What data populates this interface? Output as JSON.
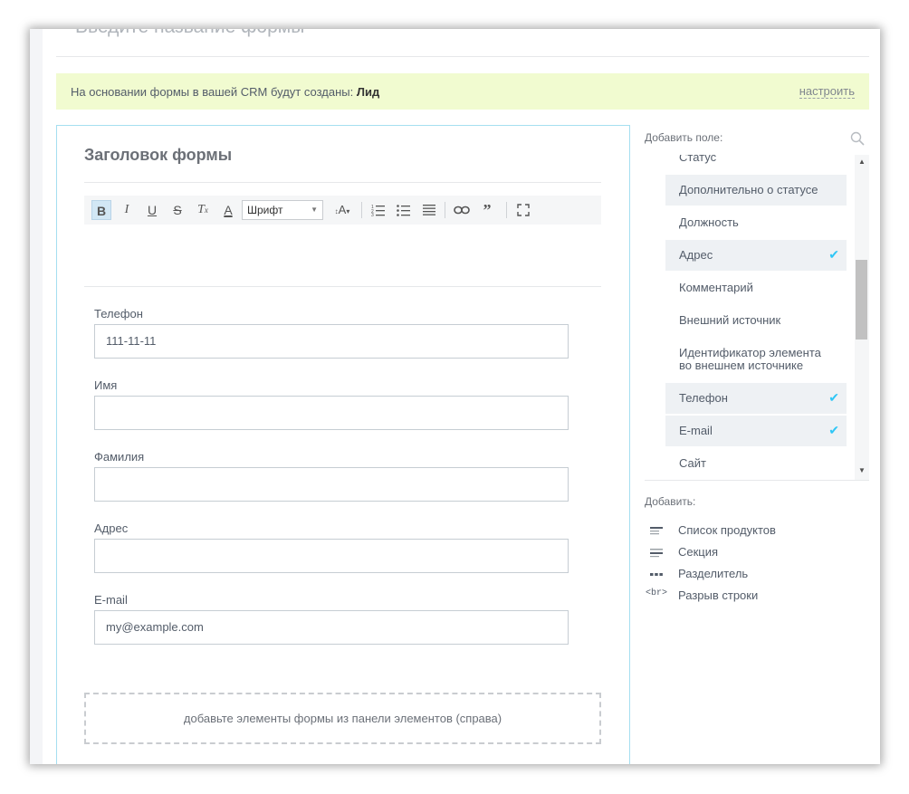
{
  "form": {
    "name_placeholder": "Введите название формы",
    "crm_notice_prefix": "На основании формы в вашей CRM будут созданы:",
    "crm_notice_entity": "Лид",
    "crm_setup_link": "настроить",
    "header_title": "Заголовок формы",
    "editor": {
      "font_select": "Шрифт",
      "buttons": [
        "bold-icon",
        "italic-icon",
        "underline-icon",
        "strikethrough-icon",
        "clear-format-icon",
        "text-color-icon",
        "font-size-icon",
        "numbered-list-icon",
        "bulleted-list-icon",
        "align-icon",
        "link-icon",
        "quote-icon",
        "fullscreen-icon"
      ]
    },
    "fields": [
      {
        "label": "Телефон",
        "value": "111-11-11"
      },
      {
        "label": "Имя",
        "value": ""
      },
      {
        "label": "Фамилия",
        "value": ""
      },
      {
        "label": "Адрес",
        "value": ""
      },
      {
        "label": "E-mail",
        "value": "my@example.com"
      }
    ],
    "drop_zone_text": "добавьте элементы формы из панели элементов (справа)"
  },
  "sidebar": {
    "add_field_label": "Добавить поле:",
    "fields": [
      {
        "label": "Статус",
        "selected": false
      },
      {
        "label": "Дополнительно о статусе",
        "selected": true,
        "checked": false
      },
      {
        "label": "Должность",
        "selected": false
      },
      {
        "label": "Адрес",
        "selected": true,
        "checked": true
      },
      {
        "label": "Комментарий",
        "selected": false
      },
      {
        "label": "Внешний источник",
        "selected": false
      },
      {
        "label": "Идентификатор элемента",
        "label2": "во внешнем источнике",
        "selected": false
      },
      {
        "label": "Телефон",
        "selected": true,
        "checked": true
      },
      {
        "label": "E-mail",
        "selected": true,
        "checked": true
      },
      {
        "label": "Сайт",
        "selected": false
      }
    ],
    "add_label": "Добавить:",
    "add_items": [
      {
        "icon": "product-list-icon",
        "label": "Список продуктов"
      },
      {
        "icon": "section-icon",
        "label": "Секция"
      },
      {
        "icon": "separator-icon",
        "label": "Разделитель"
      },
      {
        "icon": "line-break-icon",
        "icon_text": "<br>",
        "label": "Разрыв строки"
      }
    ]
  },
  "colors": {
    "accent": "#2fc6f6",
    "notice_bg": "#f1fbd0",
    "border_active": "#a5dff0"
  }
}
